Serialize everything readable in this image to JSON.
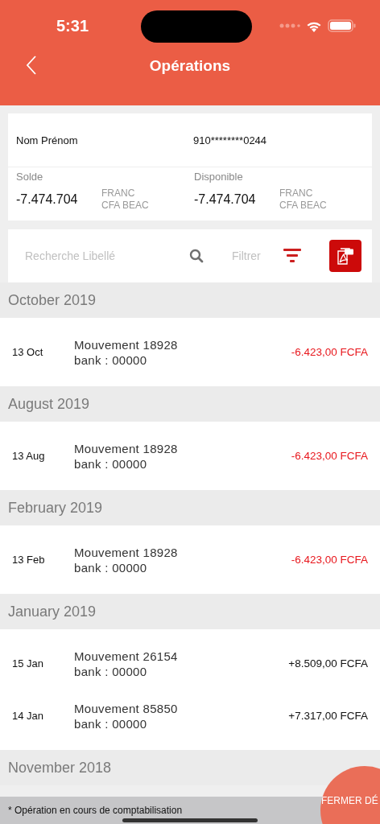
{
  "status_bar": {
    "time": "5:31"
  },
  "nav": {
    "title": "Opérations"
  },
  "account": {
    "name": "Nom Prénom",
    "number": "910********0244",
    "balances": [
      {
        "label": "Solde",
        "amount": "-7.474.704",
        "currency": "FRANC\nCFA BEAC"
      },
      {
        "label": "Disponible",
        "amount": "-7.474.704",
        "currency": "FRANC\nCFA BEAC"
      }
    ]
  },
  "toolbar": {
    "search_placeholder": "Recherche Libellé",
    "filter_label": "Filtrer"
  },
  "groups": [
    {
      "month": "October 2019",
      "operations": [
        {
          "date": "13 Oct",
          "title": "Mouvement 18928",
          "bank": "bank : 00000",
          "amount": "-6.423,00 FCFA",
          "kind": "debit"
        }
      ]
    },
    {
      "month": "August 2019",
      "operations": [
        {
          "date": "13 Aug",
          "title": "Mouvement 18928",
          "bank": "bank : 00000",
          "amount": "-6.423,00 FCFA",
          "kind": "debit"
        }
      ]
    },
    {
      "month": "February 2019",
      "operations": [
        {
          "date": "13 Feb",
          "title": "Mouvement 18928",
          "bank": "bank : 00000",
          "amount": "-6.423,00 FCFA",
          "kind": "debit"
        }
      ]
    },
    {
      "month": "January 2019",
      "operations": [
        {
          "date": "15 Jan",
          "title": "Mouvement 26154",
          "bank": "bank : 00000",
          "amount": "+8.509,00 FCFA",
          "kind": "credit"
        },
        {
          "date": "14 Jan",
          "title": "Mouvement 85850",
          "bank": "bank : 00000",
          "amount": "+7.317,00 FCFA",
          "kind": "credit"
        }
      ]
    },
    {
      "month": "November 2018"
    }
  ],
  "footer_note": "* Opération en cours de comptabilisation",
  "fab": {
    "label": "FERMER DÉ"
  }
}
